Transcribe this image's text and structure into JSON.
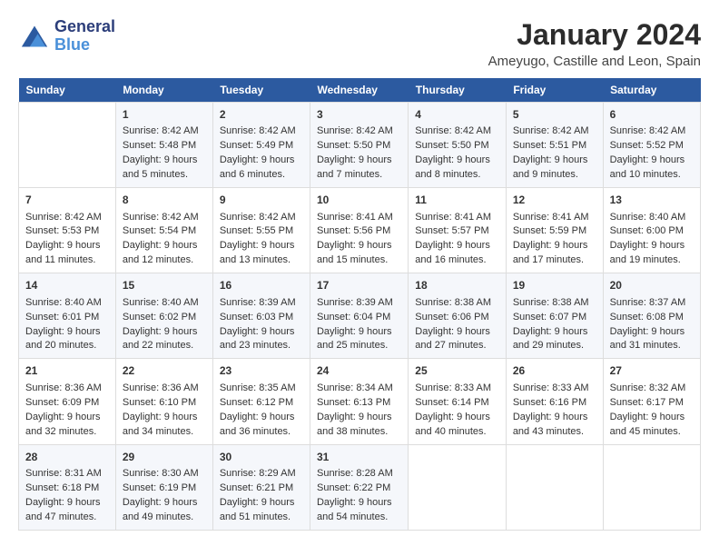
{
  "header": {
    "logo_line1": "General",
    "logo_line2": "Blue",
    "month": "January 2024",
    "location": "Ameyugo, Castille and Leon, Spain"
  },
  "weekdays": [
    "Sunday",
    "Monday",
    "Tuesday",
    "Wednesday",
    "Thursday",
    "Friday",
    "Saturday"
  ],
  "weeks": [
    [
      {
        "day": "",
        "sunrise": "",
        "sunset": "",
        "daylight": ""
      },
      {
        "day": "1",
        "sunrise": "Sunrise: 8:42 AM",
        "sunset": "Sunset: 5:48 PM",
        "daylight": "Daylight: 9 hours and 5 minutes."
      },
      {
        "day": "2",
        "sunrise": "Sunrise: 8:42 AM",
        "sunset": "Sunset: 5:49 PM",
        "daylight": "Daylight: 9 hours and 6 minutes."
      },
      {
        "day": "3",
        "sunrise": "Sunrise: 8:42 AM",
        "sunset": "Sunset: 5:50 PM",
        "daylight": "Daylight: 9 hours and 7 minutes."
      },
      {
        "day": "4",
        "sunrise": "Sunrise: 8:42 AM",
        "sunset": "Sunset: 5:50 PM",
        "daylight": "Daylight: 9 hours and 8 minutes."
      },
      {
        "day": "5",
        "sunrise": "Sunrise: 8:42 AM",
        "sunset": "Sunset: 5:51 PM",
        "daylight": "Daylight: 9 hours and 9 minutes."
      },
      {
        "day": "6",
        "sunrise": "Sunrise: 8:42 AM",
        "sunset": "Sunset: 5:52 PM",
        "daylight": "Daylight: 9 hours and 10 minutes."
      }
    ],
    [
      {
        "day": "7",
        "sunrise": "Sunrise: 8:42 AM",
        "sunset": "Sunset: 5:53 PM",
        "daylight": "Daylight: 9 hours and 11 minutes."
      },
      {
        "day": "8",
        "sunrise": "Sunrise: 8:42 AM",
        "sunset": "Sunset: 5:54 PM",
        "daylight": "Daylight: 9 hours and 12 minutes."
      },
      {
        "day": "9",
        "sunrise": "Sunrise: 8:42 AM",
        "sunset": "Sunset: 5:55 PM",
        "daylight": "Daylight: 9 hours and 13 minutes."
      },
      {
        "day": "10",
        "sunrise": "Sunrise: 8:41 AM",
        "sunset": "Sunset: 5:56 PM",
        "daylight": "Daylight: 9 hours and 15 minutes."
      },
      {
        "day": "11",
        "sunrise": "Sunrise: 8:41 AM",
        "sunset": "Sunset: 5:57 PM",
        "daylight": "Daylight: 9 hours and 16 minutes."
      },
      {
        "day": "12",
        "sunrise": "Sunrise: 8:41 AM",
        "sunset": "Sunset: 5:59 PM",
        "daylight": "Daylight: 9 hours and 17 minutes."
      },
      {
        "day": "13",
        "sunrise": "Sunrise: 8:40 AM",
        "sunset": "Sunset: 6:00 PM",
        "daylight": "Daylight: 9 hours and 19 minutes."
      }
    ],
    [
      {
        "day": "14",
        "sunrise": "Sunrise: 8:40 AM",
        "sunset": "Sunset: 6:01 PM",
        "daylight": "Daylight: 9 hours and 20 minutes."
      },
      {
        "day": "15",
        "sunrise": "Sunrise: 8:40 AM",
        "sunset": "Sunset: 6:02 PM",
        "daylight": "Daylight: 9 hours and 22 minutes."
      },
      {
        "day": "16",
        "sunrise": "Sunrise: 8:39 AM",
        "sunset": "Sunset: 6:03 PM",
        "daylight": "Daylight: 9 hours and 23 minutes."
      },
      {
        "day": "17",
        "sunrise": "Sunrise: 8:39 AM",
        "sunset": "Sunset: 6:04 PM",
        "daylight": "Daylight: 9 hours and 25 minutes."
      },
      {
        "day": "18",
        "sunrise": "Sunrise: 8:38 AM",
        "sunset": "Sunset: 6:06 PM",
        "daylight": "Daylight: 9 hours and 27 minutes."
      },
      {
        "day": "19",
        "sunrise": "Sunrise: 8:38 AM",
        "sunset": "Sunset: 6:07 PM",
        "daylight": "Daylight: 9 hours and 29 minutes."
      },
      {
        "day": "20",
        "sunrise": "Sunrise: 8:37 AM",
        "sunset": "Sunset: 6:08 PM",
        "daylight": "Daylight: 9 hours and 31 minutes."
      }
    ],
    [
      {
        "day": "21",
        "sunrise": "Sunrise: 8:36 AM",
        "sunset": "Sunset: 6:09 PM",
        "daylight": "Daylight: 9 hours and 32 minutes."
      },
      {
        "day": "22",
        "sunrise": "Sunrise: 8:36 AM",
        "sunset": "Sunset: 6:10 PM",
        "daylight": "Daylight: 9 hours and 34 minutes."
      },
      {
        "day": "23",
        "sunrise": "Sunrise: 8:35 AM",
        "sunset": "Sunset: 6:12 PM",
        "daylight": "Daylight: 9 hours and 36 minutes."
      },
      {
        "day": "24",
        "sunrise": "Sunrise: 8:34 AM",
        "sunset": "Sunset: 6:13 PM",
        "daylight": "Daylight: 9 hours and 38 minutes."
      },
      {
        "day": "25",
        "sunrise": "Sunrise: 8:33 AM",
        "sunset": "Sunset: 6:14 PM",
        "daylight": "Daylight: 9 hours and 40 minutes."
      },
      {
        "day": "26",
        "sunrise": "Sunrise: 8:33 AM",
        "sunset": "Sunset: 6:16 PM",
        "daylight": "Daylight: 9 hours and 43 minutes."
      },
      {
        "day": "27",
        "sunrise": "Sunrise: 8:32 AM",
        "sunset": "Sunset: 6:17 PM",
        "daylight": "Daylight: 9 hours and 45 minutes."
      }
    ],
    [
      {
        "day": "28",
        "sunrise": "Sunrise: 8:31 AM",
        "sunset": "Sunset: 6:18 PM",
        "daylight": "Daylight: 9 hours and 47 minutes."
      },
      {
        "day": "29",
        "sunrise": "Sunrise: 8:30 AM",
        "sunset": "Sunset: 6:19 PM",
        "daylight": "Daylight: 9 hours and 49 minutes."
      },
      {
        "day": "30",
        "sunrise": "Sunrise: 8:29 AM",
        "sunset": "Sunset: 6:21 PM",
        "daylight": "Daylight: 9 hours and 51 minutes."
      },
      {
        "day": "31",
        "sunrise": "Sunrise: 8:28 AM",
        "sunset": "Sunset: 6:22 PM",
        "daylight": "Daylight: 9 hours and 54 minutes."
      },
      {
        "day": "",
        "sunrise": "",
        "sunset": "",
        "daylight": ""
      },
      {
        "day": "",
        "sunrise": "",
        "sunset": "",
        "daylight": ""
      },
      {
        "day": "",
        "sunrise": "",
        "sunset": "",
        "daylight": ""
      }
    ]
  ]
}
